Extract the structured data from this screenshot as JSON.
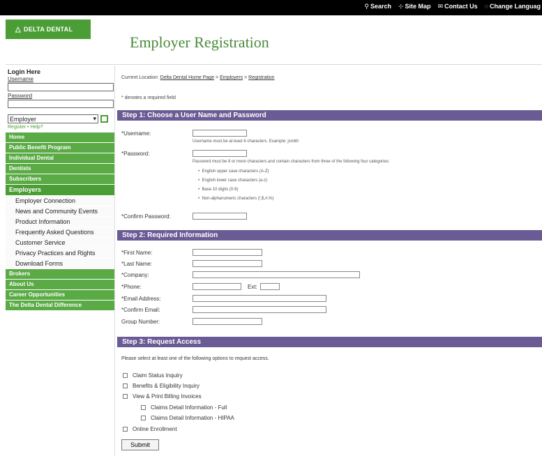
{
  "topnav": {
    "search": "Search",
    "site_map": "Site Map",
    "contact_us": "Contact Us",
    "change_language": "Change Languag"
  },
  "logo": {
    "text": "DELTA DENTAL"
  },
  "page_title": "Employer Registration",
  "login": {
    "heading": "Login Here",
    "username_label": "Username",
    "password_label": "Password",
    "role_select": "Employer",
    "register_help": "Register • Help?"
  },
  "nav": {
    "home": "Home",
    "public_benefit": "Public Benefit Program",
    "individual_dental": "Individual Dental",
    "dentists": "Dentists",
    "subscribers": "Subscribers",
    "employers": "Employers",
    "employers_sub": [
      "Employer Connection",
      "News and Community Events",
      "Product Information",
      "Frequently Asked Questions",
      "Customer Service",
      "Privacy Practices and Rights",
      "Download Forms"
    ],
    "brokers": "Brokers",
    "about_us": "About Us",
    "career": "Career Opportunities",
    "difference": "The Delta Dental Difference"
  },
  "breadcrumb": {
    "prefix": "Current Location:",
    "home": "Delta Dental Home Page",
    "sep1": ">",
    "employers": "Employers",
    "sep2": ">",
    "registration": "Registration"
  },
  "required_note": "* denotes a required field",
  "step1": {
    "title": "Step 1: Choose a User Name and Password",
    "username_label": "*Username:",
    "username_hint": "Username must be at least 6 characters. Example: jsmith",
    "password_label": "*Password:",
    "password_hint": "Password must be 8 or more characters and contain characters from three of the following four categories:",
    "rules": [
      "English upper case characters (A-Z)",
      "English lower case characters (a-z)",
      "Base 10 digits (0-9)",
      "Non-alphanumeric characters (!,$,#,%)"
    ],
    "confirm_label": "*Confirm Password:"
  },
  "step2": {
    "title": "Step 2: Required Information",
    "first_name": "*First Name:",
    "last_name": "*Last Name:",
    "company": "*Company:",
    "phone": "*Phone:",
    "ext": "Ext:",
    "email": "*Email Address:",
    "confirm_email": "*Confirm Email:",
    "group_number": "Group Number:"
  },
  "step3": {
    "title": "Step 3: Request Access",
    "instruction": "Please select at least one of the following options to request access.",
    "options": {
      "claim_status": "Claim Status Inquiry",
      "benefits": "Benefits & Eligibility Inquiry",
      "billing": "View & Print Billing Invoices",
      "claims_full": "Claims Detail Information - Full",
      "claims_hipaa": "Claims Detail Information - HIPAA",
      "enrollment": "Online Enrollment"
    },
    "submit": "Submit"
  }
}
